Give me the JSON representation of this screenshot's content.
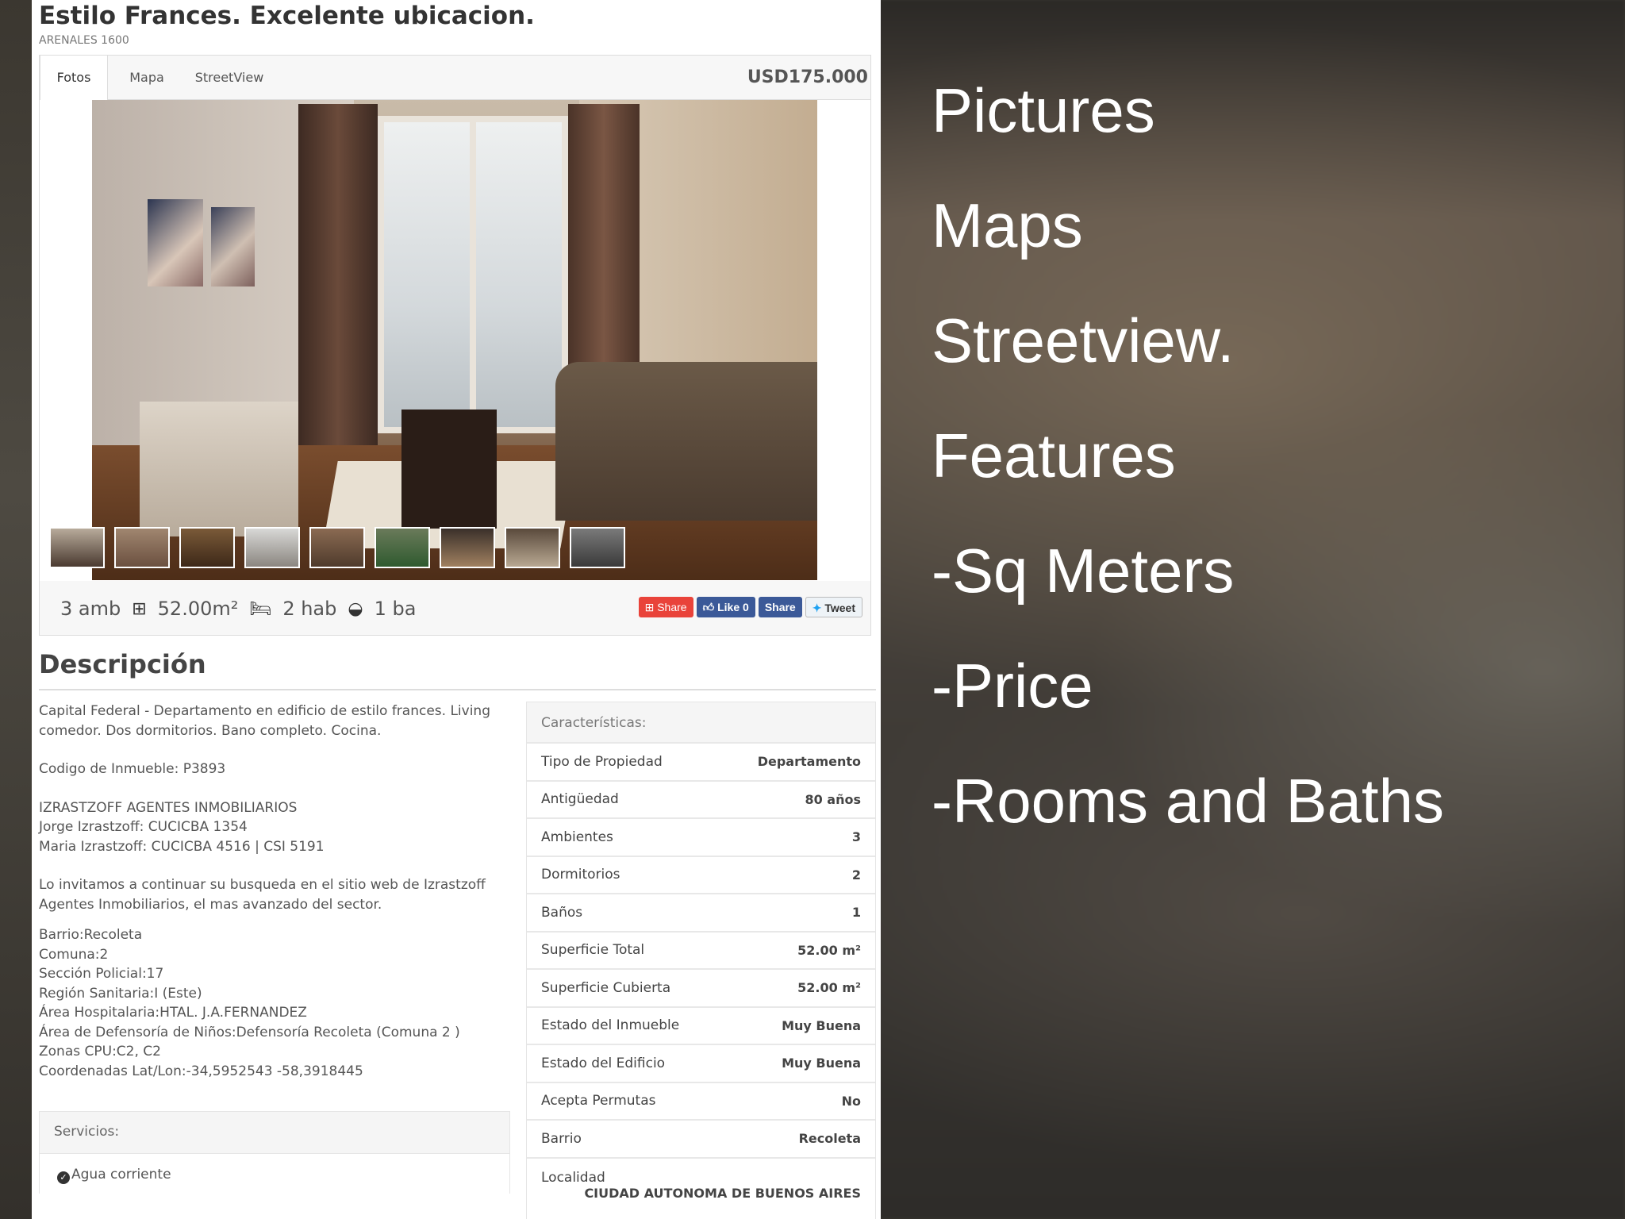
{
  "listing": {
    "title": "Estilo Frances. Excelente ubicacion.",
    "address": "ARENALES 1600",
    "price": "USD175.000",
    "tabs": [
      {
        "label": "Fotos",
        "active": true
      },
      {
        "label": "Mapa",
        "active": false
      },
      {
        "label": "StreetView",
        "active": false
      }
    ],
    "thumbnails_count": 9,
    "features": {
      "ambientes": "3 amb",
      "area": "52.00m²",
      "habitaciones": "2 hab",
      "banos": "1 ba",
      "icons": [
        "floorplan-icon",
        "bed-icon",
        "bathtub-icon"
      ]
    },
    "social": {
      "share_label": "Share",
      "like_label": "Like 0",
      "fb_share_label": "Share",
      "tweet_label": "Tweet"
    }
  },
  "description": {
    "title": "Descripción",
    "paragraphs": [
      "Capital Federal - Departamento en edificio de estilo frances. Living comedor. Dos dormitorios. Bano completo. Cocina.",
      "Codigo de Inmueble: P3893",
      "IZRASTZOFF AGENTES INMOBILIARIOS\nJorge Izrastzoff: CUCICBA 1354\nMaria Izrastzoff: CUCICBA 4516 | CSI 5191",
      "Lo invitamos a continuar su busqueda en el sitio web de Izrastzoff Agentes Inmobiliarios, el mas avanzado del sector."
    ],
    "location_details": [
      "Barrio:Recoleta",
      "Comuna:2",
      "Sección Policial:17",
      "Región Sanitaria:I (Este)",
      "Área Hospitalaria:HTAL. J.A.FERNANDEZ",
      "Área de Defensoría de Niños:Defensoría Recoleta (Comuna 2 )",
      "Zonas CPU:C2, C2",
      "Coordenadas Lat/Lon:-34,5952543 -58,3918445"
    ]
  },
  "servicios": {
    "title": "Servicios:",
    "items": [
      "Agua corriente"
    ]
  },
  "caracteristicas": {
    "title": "Características:",
    "rows": [
      {
        "label": "Tipo de Propiedad",
        "value": "Departamento"
      },
      {
        "label": "Antigüedad",
        "value": "80 años"
      },
      {
        "label": "Ambientes",
        "value": "3"
      },
      {
        "label": "Dormitorios",
        "value": "2"
      },
      {
        "label": "Baños",
        "value": "1"
      },
      {
        "label": "Superficie Total",
        "value": "52.00 m²"
      },
      {
        "label": "Superficie Cubierta",
        "value": "52.00 m²"
      },
      {
        "label": "Estado del Inmueble",
        "value": "Muy Buena"
      },
      {
        "label": "Estado del Edificio",
        "value": "Muy Buena"
      },
      {
        "label": "Acepta Permutas",
        "value": "No"
      },
      {
        "label": "Barrio",
        "value": "Recoleta"
      },
      {
        "label": "Localidad",
        "value": "CIUDAD AUTONOMA DE BUENOS AIRES"
      }
    ]
  },
  "overlay": {
    "items": [
      "Pictures",
      "Maps",
      "Streetview.",
      "Features",
      "-Sq Meters",
      "-Price",
      "-Rooms and Baths"
    ]
  }
}
